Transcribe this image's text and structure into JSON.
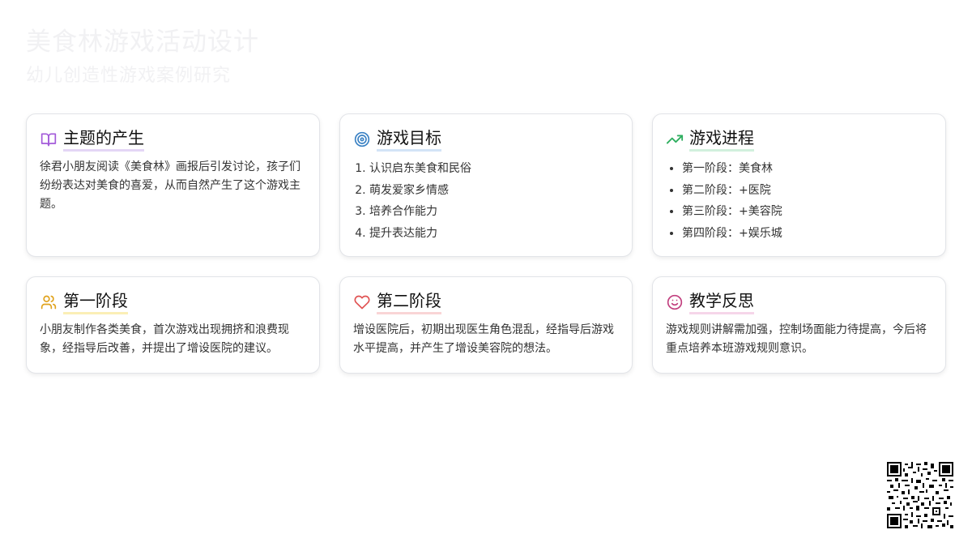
{
  "header": {
    "title": "美食林游戏活动设计",
    "subtitle": "幼儿创造性游戏案例研究"
  },
  "cards": [
    {
      "icon": "book-open-icon",
      "title": "主题的产生",
      "text": "徐君小朋友阅读《美食林》画报后引发讨论，孩子们纷纷表达对美食的喜爱，从而自然产生了这个游戏主题。"
    },
    {
      "icon": "target-icon",
      "title": "游戏目标",
      "items": [
        "认识启东美食和民俗",
        "萌发爱家乡情感",
        "培养合作能力",
        "提升表达能力"
      ]
    },
    {
      "icon": "trending-up-icon",
      "title": "游戏进程",
      "items": [
        "第一阶段：美食林",
        "第二阶段：+医院",
        "第三阶段：+美容院",
        "第四阶段：+娱乐城"
      ]
    },
    {
      "icon": "users-icon",
      "title": "第一阶段",
      "text": "小朋友制作各类美食，首次游戏出现拥挤和浪费现象，经指导后改善，并提出了增设医院的建议。"
    },
    {
      "icon": "heart-icon",
      "title": "第二阶段",
      "text": "增设医院后，初期出现医生角色混乱，经指导后游戏水平提高，并产生了增设美容院的想法。"
    },
    {
      "icon": "smile-icon",
      "title": "教学反思",
      "text": "游戏规则讲解需加强，控制场面能力待提高，今后将重点培养本班游戏规则意识。"
    }
  ],
  "colors": {
    "book": "#a259d9",
    "target": "#3b82c4",
    "trend": "#2eae5f",
    "users": "#e0a21b",
    "heart": "#e05252",
    "smile": "#c2407f"
  }
}
